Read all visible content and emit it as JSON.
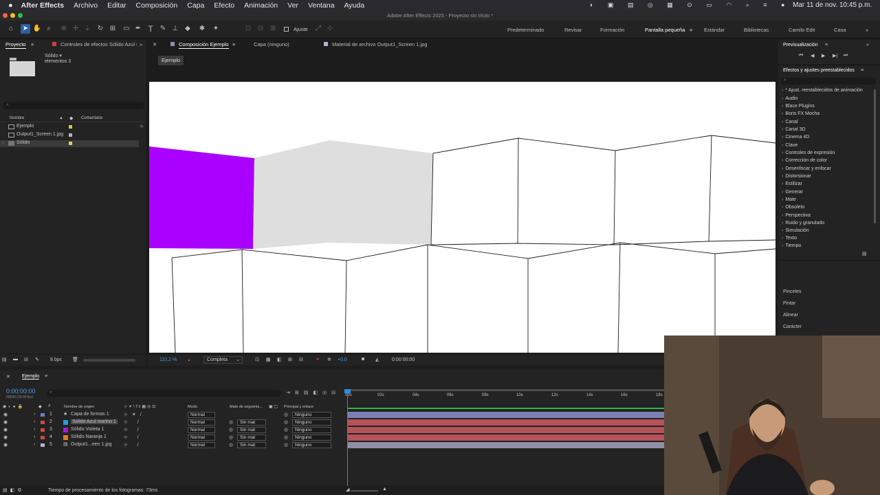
{
  "menubar": {
    "app": "After Effects",
    "items": [
      "Archivo",
      "Editar",
      "Composición",
      "Capa",
      "Efecto",
      "Animación",
      "Ver",
      "Ventana",
      "Ayuda"
    ],
    "clock": "Mar 11 de nov.  10:45 p.m."
  },
  "window_title": "Adobe After Effects 2025 - Proyecto sin título *",
  "toolbar": {
    "snap_label": "Ajuste",
    "workspaces": [
      "Predeterminado",
      "Revisar",
      "Formación",
      "Pantalla pequeña",
      "Estándar",
      "Bibliotecas",
      "Camilo Edit",
      "Casa"
    ],
    "active_workspace": "Pantalla pequeña"
  },
  "project": {
    "tab": "Proyecto",
    "effects_tab": "Controles de efectos Sólido Azul m",
    "selected_info_line1": "Sólido ▾",
    "selected_info_line2": "elementos 3",
    "col_name": "Nombre",
    "col_comment": "Comentario",
    "items": [
      {
        "name": "Ejemplo",
        "color": "#c9c95a"
      },
      {
        "name": "Output1_Screen 1.jpg",
        "color": "#b4b4d4"
      },
      {
        "name": "Sólido",
        "color": "#e0d35a"
      }
    ],
    "bpc": "8 bpc"
  },
  "viewer": {
    "tabs": [
      "Composición Ejemplo",
      "Capa (ninguno)",
      "Material de archivo Output1_Screen 1.jpg"
    ],
    "breadcrumb": "Ejemplo",
    "zoom": "110,2 %",
    "resolution": "Completa",
    "exposure": "+0,0",
    "timecode": "0:00:00:00"
  },
  "right": {
    "preview_tab": "Previsualización",
    "effects_tab": "Efectos y ajustes preestablecidos",
    "search_placeholder": "",
    "categories": [
      "* Ajust. reestablecidos de animación",
      "Audio",
      "Blace Plugins",
      "Boris FX Mocha",
      "Canal",
      "Canal 3D",
      "Cinema 4D",
      "Clave",
      "Controles de expresión",
      "Corrección de color",
      "Desenfocar y enfocar",
      "Distorsionar",
      "Estilizar",
      "Generar",
      "Mate",
      "Obsoleto",
      "Perspectiva",
      "Ruido y granulado",
      "Simulación",
      "Texto",
      "Tiempo"
    ],
    "panels": [
      "Pinceles",
      "Pintar",
      "Alinear",
      "Carácter"
    ]
  },
  "timeline": {
    "tab": "Ejemplo",
    "timecode": "0:00:00:00",
    "fps": "00000 (24.00 fps)",
    "col_source": "Nombre de origen",
    "col_mode": "Modo",
    "col_matte": "Mate de seguimie...",
    "col_parent": "Principal y enlace",
    "ruler": [
      "00s",
      "02s",
      "04s",
      "06s",
      "08s",
      "10s",
      "12s",
      "14s",
      "16s",
      "18s"
    ],
    "layers": [
      {
        "num": "1",
        "name": "Capa de formas 1",
        "label": "#6c82c8",
        "mode": "Normal",
        "matte": "",
        "parent": "Ninguno",
        "bar": "#7a7fb4"
      },
      {
        "num": "2",
        "name": "Sólido Azul marino 1",
        "label": "#1fa0d8",
        "mode": "Normal",
        "matte": "Sin mat",
        "parent": "Ninguno",
        "bar": "#b5525a"
      },
      {
        "num": "3",
        "name": "Sólido Violeta 1",
        "label": "#a51fd8",
        "mode": "Normal",
        "matte": "Sin mat",
        "parent": "Ninguno",
        "bar": "#b5525a"
      },
      {
        "num": "4",
        "name": "Sólido Naranja 1",
        "label": "#e0801f",
        "mode": "Normal",
        "matte": "Sin mat",
        "parent": "Ninguno",
        "bar": "#b5525a"
      },
      {
        "num": "5",
        "name": "Output1...een 1.jpg",
        "label": "#b4b4d4",
        "mode": "Normal",
        "matte": "Sin mat",
        "parent": "Ninguno",
        "bar": "#8f8fa8"
      }
    ]
  },
  "status": {
    "render_time": "Tiempo de procesamiento de los fotogramas: 73ms"
  },
  "colors": {
    "accent": "#2d8ceb",
    "magenta": "#aa00ff",
    "solid_grey": "#dedede"
  }
}
